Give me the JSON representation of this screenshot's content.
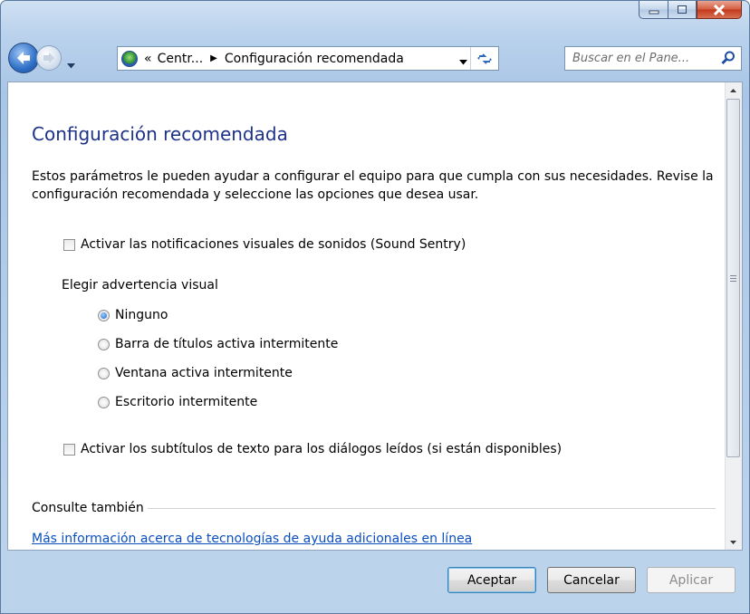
{
  "window": {
    "caption_buttons": {
      "minimize": "minimize",
      "maximize": "maximize",
      "close": "close"
    }
  },
  "address": {
    "chevron": "«",
    "crumb1": "Centr...",
    "separator": "▶",
    "crumb2": "Configuración recomendada"
  },
  "search": {
    "placeholder": "Buscar en el Pane..."
  },
  "page": {
    "title": "Configuración recomendada",
    "description": "Estos parámetros le pueden ayudar a configurar el equipo para que cumpla con sus necesidades. Revise la configuración recomendada y seleccione las opciones que desea usar.",
    "checkbox_sound_sentry": {
      "label": "Activar las notificaciones visuales de sonidos (Sound Sentry)",
      "checked": false
    },
    "visual_warning_label": "Elegir advertencia visual",
    "radios": [
      {
        "label": "Ninguno",
        "selected": true
      },
      {
        "label": "Barra de títulos activa intermitente",
        "selected": false
      },
      {
        "label": "Ventana activa intermitente",
        "selected": false
      },
      {
        "label": "Escritorio intermitente",
        "selected": false
      }
    ],
    "checkbox_captions": {
      "label": "Activar los subtítulos de texto para los diálogos leídos (si están disponibles)",
      "checked": false
    },
    "see_also": "Consulte también",
    "link": "Más información acerca de tecnologías de ayuda adicionales en línea"
  },
  "buttons": {
    "ok": "Aceptar",
    "cancel": "Cancelar",
    "apply": "Aplicar"
  },
  "colors": {
    "title": "#1e3287",
    "link": "#0a4fbe",
    "close_button": "#c2381b"
  }
}
